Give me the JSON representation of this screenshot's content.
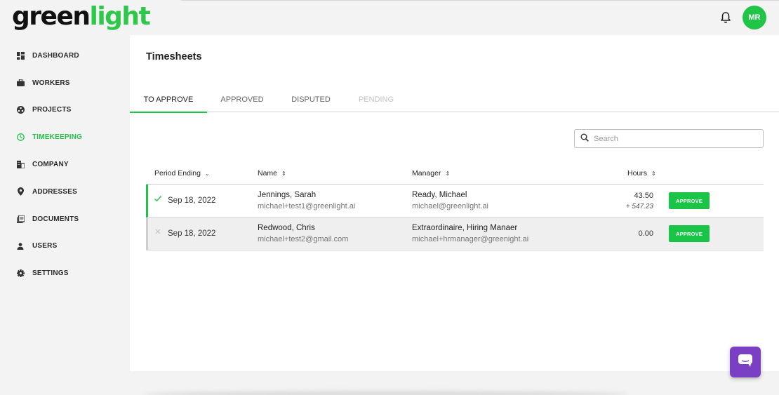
{
  "logo": {
    "part1": "green",
    "part2": "light"
  },
  "header": {
    "avatar_initials": "MR",
    "bell_icon": "bell-icon"
  },
  "sidebar": {
    "items": [
      {
        "label": "DASHBOARD",
        "icon": "dashboard-icon"
      },
      {
        "label": "WORKERS",
        "icon": "briefcase-icon"
      },
      {
        "label": "PROJECTS",
        "icon": "projects-icon"
      },
      {
        "label": "TIMEKEEPING",
        "icon": "clock-icon",
        "active": true
      },
      {
        "label": "COMPANY",
        "icon": "building-icon"
      },
      {
        "label": "ADDRESSES",
        "icon": "location-pin-icon"
      },
      {
        "label": "DOCUMENTS",
        "icon": "documents-icon"
      },
      {
        "label": "USERS",
        "icon": "user-icon"
      },
      {
        "label": "SETTINGS",
        "icon": "gear-icon"
      }
    ]
  },
  "main": {
    "title": "Timesheets",
    "tabs": [
      {
        "label": "TO APPROVE",
        "active": true
      },
      {
        "label": "APPROVED"
      },
      {
        "label": "DISPUTED"
      },
      {
        "label": "PENDING",
        "disabled": true
      }
    ],
    "search": {
      "placeholder": "Search"
    },
    "table": {
      "headers": {
        "period": "Period Ending",
        "name": "Name",
        "manager": "Manager",
        "hours": "Hours"
      },
      "rows": [
        {
          "status": "check",
          "date": "Sep 18, 2022",
          "name": "Jennings, Sarah",
          "email": "michael+test1@greenlight.ai",
          "manager": "Ready, Michael",
          "manager_email": "michael@greenlight.ai",
          "hours": "43.50",
          "hours_extra": "+ 547.23",
          "action": "APPROVE"
        },
        {
          "status": "x",
          "date": "Sep 18, 2022",
          "name": "Redwood, Chris",
          "email": "michael+test2@gmail.com",
          "manager": "Extraordinaire, Hiring Manaer",
          "manager_email": "michael+hrmanager@greenight.ai",
          "hours": "0.00",
          "action": "APPROVE"
        }
      ]
    }
  },
  "colors": {
    "brand": "#22c247",
    "chat": "#7b3fc4"
  }
}
